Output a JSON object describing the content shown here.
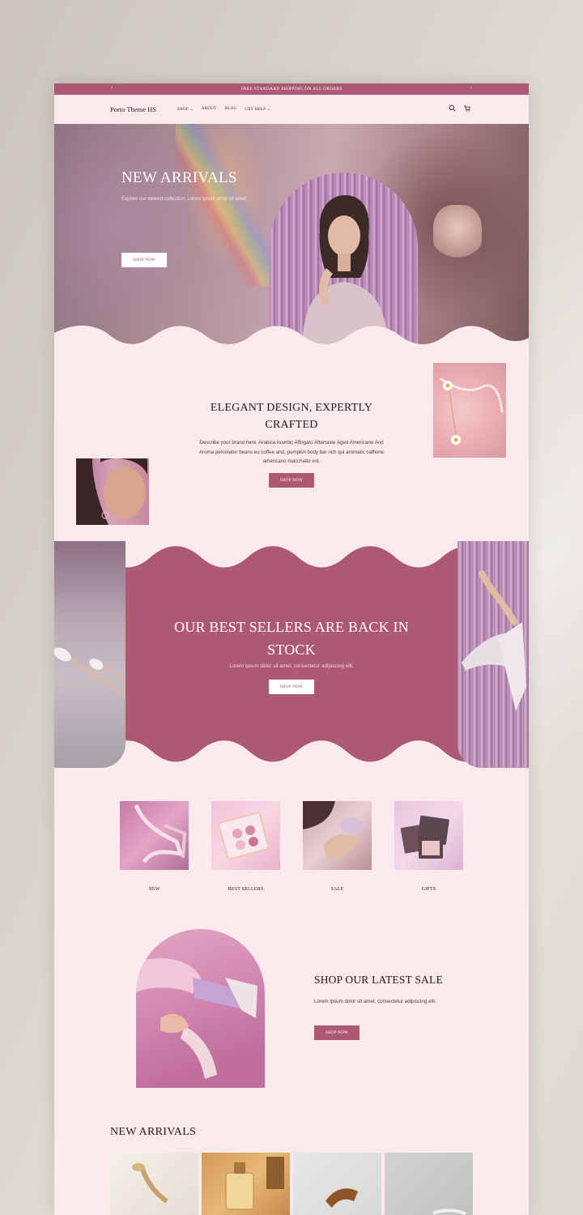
{
  "announcement": {
    "text": "FREE STANDARD SHIPPING ON ALL ORDERS",
    "prev": "‹",
    "next": "›"
  },
  "header": {
    "logo": "Porto Theme HS",
    "nav": [
      {
        "label": "SHOP",
        "has_dropdown": true,
        "chevron": "⌄"
      },
      {
        "label": "ABOUT",
        "has_dropdown": false,
        "chevron": ""
      },
      {
        "label": "BLOG",
        "has_dropdown": false,
        "chevron": ""
      },
      {
        "label": "GET HELP",
        "has_dropdown": true,
        "chevron": "⌄"
      }
    ],
    "icons": [
      "search-icon",
      "cart-icon"
    ]
  },
  "hero": {
    "title": "NEW ARRIVALS",
    "subtitle": "Explore our newest collection. Lorem ipsum dolor sit amet",
    "button": "SHOP NOW"
  },
  "brand": {
    "title": "ELEGANT DESIGN, EXPERTLY CRAFTED",
    "description": "Describe your brand here. Arabica Acerbic Affogato Aftertaste Aged Americano And Aroma percolator beans eu coffee and, pumpkin body bar rich qui aromatic caffeine americano macchiato est.",
    "button": "SHOP NOW"
  },
  "best_sellers": {
    "title": "OUR BEST SELLERS ARE BACK IN STOCK",
    "subtitle": "Lorem ipsum dolor sit amet, consectetur adipiscing elit.",
    "button": "SHOP NOW"
  },
  "categories": [
    {
      "label": "NEW"
    },
    {
      "label": "BEST SELLERS"
    },
    {
      "label": "SALE"
    },
    {
      "label": "GIFTS"
    }
  ],
  "sale": {
    "title": "SHOP OUR LATEST SALE",
    "description": "Lorem ipsum dolor sit amet, consectetur adipiscing elit.",
    "button": "SHOP NOW"
  },
  "new_arrivals": {
    "title": "NEW ARRIVALS"
  },
  "colors": {
    "rose": "#ad5875",
    "blush": "#fbeaeb",
    "ink": "#24181d"
  }
}
